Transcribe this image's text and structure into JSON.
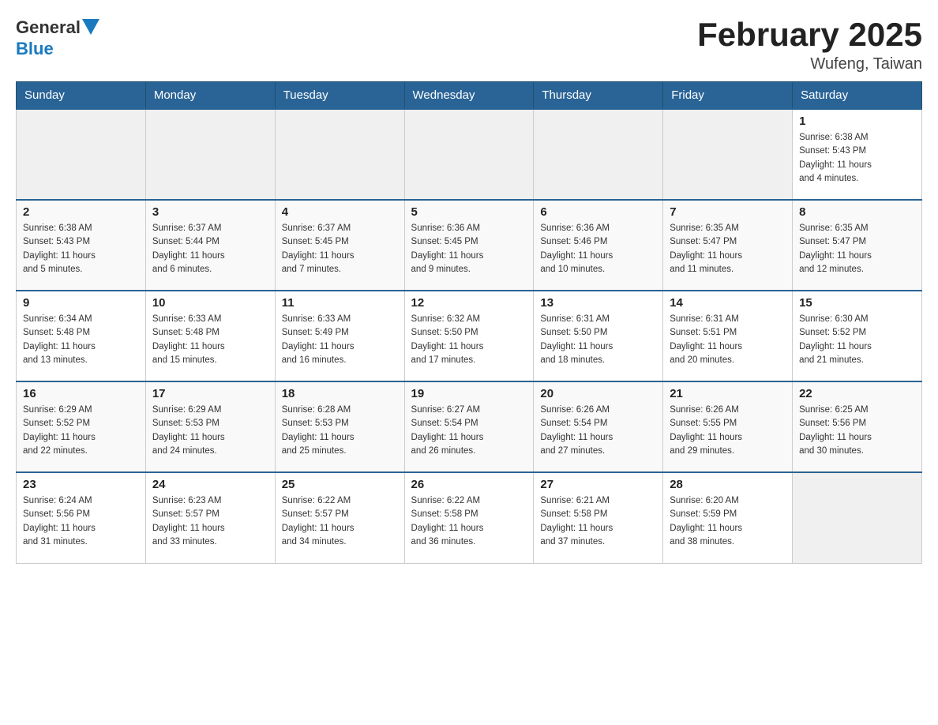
{
  "header": {
    "logo_general": "General",
    "logo_blue": "Blue",
    "month_title": "February 2025",
    "location": "Wufeng, Taiwan"
  },
  "days_of_week": [
    "Sunday",
    "Monday",
    "Tuesday",
    "Wednesday",
    "Thursday",
    "Friday",
    "Saturday"
  ],
  "weeks": [
    [
      {
        "day": "",
        "info": ""
      },
      {
        "day": "",
        "info": ""
      },
      {
        "day": "",
        "info": ""
      },
      {
        "day": "",
        "info": ""
      },
      {
        "day": "",
        "info": ""
      },
      {
        "day": "",
        "info": ""
      },
      {
        "day": "1",
        "info": "Sunrise: 6:38 AM\nSunset: 5:43 PM\nDaylight: 11 hours\nand 4 minutes."
      }
    ],
    [
      {
        "day": "2",
        "info": "Sunrise: 6:38 AM\nSunset: 5:43 PM\nDaylight: 11 hours\nand 5 minutes."
      },
      {
        "day": "3",
        "info": "Sunrise: 6:37 AM\nSunset: 5:44 PM\nDaylight: 11 hours\nand 6 minutes."
      },
      {
        "day": "4",
        "info": "Sunrise: 6:37 AM\nSunset: 5:45 PM\nDaylight: 11 hours\nand 7 minutes."
      },
      {
        "day": "5",
        "info": "Sunrise: 6:36 AM\nSunset: 5:45 PM\nDaylight: 11 hours\nand 9 minutes."
      },
      {
        "day": "6",
        "info": "Sunrise: 6:36 AM\nSunset: 5:46 PM\nDaylight: 11 hours\nand 10 minutes."
      },
      {
        "day": "7",
        "info": "Sunrise: 6:35 AM\nSunset: 5:47 PM\nDaylight: 11 hours\nand 11 minutes."
      },
      {
        "day": "8",
        "info": "Sunrise: 6:35 AM\nSunset: 5:47 PM\nDaylight: 11 hours\nand 12 minutes."
      }
    ],
    [
      {
        "day": "9",
        "info": "Sunrise: 6:34 AM\nSunset: 5:48 PM\nDaylight: 11 hours\nand 13 minutes."
      },
      {
        "day": "10",
        "info": "Sunrise: 6:33 AM\nSunset: 5:48 PM\nDaylight: 11 hours\nand 15 minutes."
      },
      {
        "day": "11",
        "info": "Sunrise: 6:33 AM\nSunset: 5:49 PM\nDaylight: 11 hours\nand 16 minutes."
      },
      {
        "day": "12",
        "info": "Sunrise: 6:32 AM\nSunset: 5:50 PM\nDaylight: 11 hours\nand 17 minutes."
      },
      {
        "day": "13",
        "info": "Sunrise: 6:31 AM\nSunset: 5:50 PM\nDaylight: 11 hours\nand 18 minutes."
      },
      {
        "day": "14",
        "info": "Sunrise: 6:31 AM\nSunset: 5:51 PM\nDaylight: 11 hours\nand 20 minutes."
      },
      {
        "day": "15",
        "info": "Sunrise: 6:30 AM\nSunset: 5:52 PM\nDaylight: 11 hours\nand 21 minutes."
      }
    ],
    [
      {
        "day": "16",
        "info": "Sunrise: 6:29 AM\nSunset: 5:52 PM\nDaylight: 11 hours\nand 22 minutes."
      },
      {
        "day": "17",
        "info": "Sunrise: 6:29 AM\nSunset: 5:53 PM\nDaylight: 11 hours\nand 24 minutes."
      },
      {
        "day": "18",
        "info": "Sunrise: 6:28 AM\nSunset: 5:53 PM\nDaylight: 11 hours\nand 25 minutes."
      },
      {
        "day": "19",
        "info": "Sunrise: 6:27 AM\nSunset: 5:54 PM\nDaylight: 11 hours\nand 26 minutes."
      },
      {
        "day": "20",
        "info": "Sunrise: 6:26 AM\nSunset: 5:54 PM\nDaylight: 11 hours\nand 27 minutes."
      },
      {
        "day": "21",
        "info": "Sunrise: 6:26 AM\nSunset: 5:55 PM\nDaylight: 11 hours\nand 29 minutes."
      },
      {
        "day": "22",
        "info": "Sunrise: 6:25 AM\nSunset: 5:56 PM\nDaylight: 11 hours\nand 30 minutes."
      }
    ],
    [
      {
        "day": "23",
        "info": "Sunrise: 6:24 AM\nSunset: 5:56 PM\nDaylight: 11 hours\nand 31 minutes."
      },
      {
        "day": "24",
        "info": "Sunrise: 6:23 AM\nSunset: 5:57 PM\nDaylight: 11 hours\nand 33 minutes."
      },
      {
        "day": "25",
        "info": "Sunrise: 6:22 AM\nSunset: 5:57 PM\nDaylight: 11 hours\nand 34 minutes."
      },
      {
        "day": "26",
        "info": "Sunrise: 6:22 AM\nSunset: 5:58 PM\nDaylight: 11 hours\nand 36 minutes."
      },
      {
        "day": "27",
        "info": "Sunrise: 6:21 AM\nSunset: 5:58 PM\nDaylight: 11 hours\nand 37 minutes."
      },
      {
        "day": "28",
        "info": "Sunrise: 6:20 AM\nSunset: 5:59 PM\nDaylight: 11 hours\nand 38 minutes."
      },
      {
        "day": "",
        "info": ""
      }
    ]
  ]
}
